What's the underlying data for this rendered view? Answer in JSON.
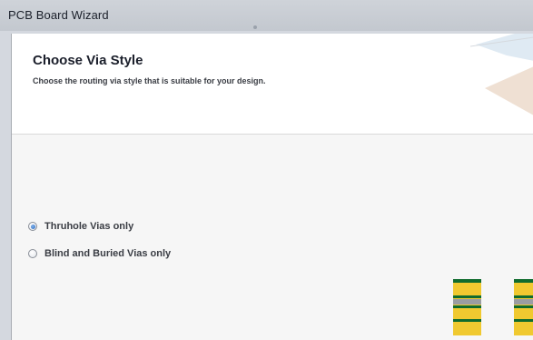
{
  "window": {
    "title": "PCB Board Wizard"
  },
  "header": {
    "title": "Choose Via Style",
    "subtitle": "Choose  the routing via style that is suitable for your design."
  },
  "options": {
    "items": [
      {
        "label": "Thruhole Vias only",
        "checked": true
      },
      {
        "label": "Blind and Buried Vias only",
        "checked": false
      }
    ]
  },
  "colors": {
    "via_copper": "#f0c930",
    "via_pad": "#0f6b2e",
    "via_barrel": "#9a9da2"
  }
}
